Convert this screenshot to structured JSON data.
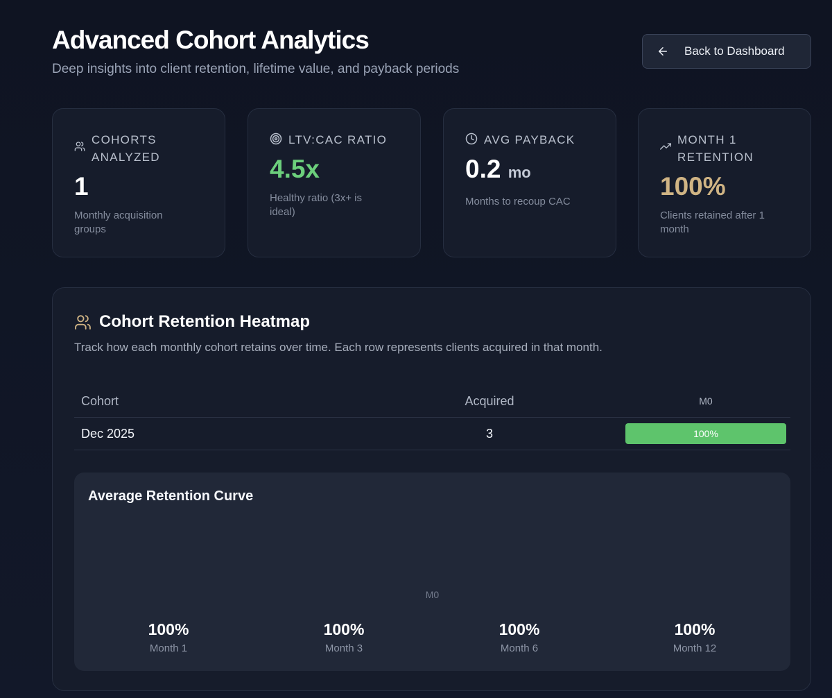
{
  "header": {
    "title": "Advanced Cohort Analytics",
    "subtitle": "Deep insights into client retention, lifetime value, and payback periods",
    "back_button": "Back to Dashboard",
    "back_icon": "arrow-left-icon"
  },
  "stats": [
    {
      "icon": "users-icon",
      "label": "COHORTS ANALYZED",
      "value": "1",
      "unit": "",
      "note": "Monthly acquisition groups",
      "color": "#ffffff"
    },
    {
      "icon": "target-icon",
      "label": "LTV:CAC RATIO",
      "value": "4.5x",
      "unit": "",
      "note": "Healthy ratio (3x+ is ideal)",
      "color": "#6ccf7c"
    },
    {
      "icon": "clock-icon",
      "label": "AVG PAYBACK",
      "value": "0.2",
      "unit": "mo",
      "note": "Months to recoup CAC",
      "color": "#ffffff"
    },
    {
      "icon": "trending-up-icon",
      "label": "MONTH 1 RETENTION",
      "value": "100%",
      "unit": "",
      "note": "Clients retained after 1 month",
      "color": "#d0b484"
    }
  ],
  "heatmap": {
    "title": "Cohort Retention Heatmap",
    "icon": "users-icon",
    "description": "Track how each monthly cohort retains over time. Each row represents clients acquired in that month.",
    "columns": [
      "Cohort",
      "Acquired",
      "M0"
    ],
    "rows": [
      {
        "cohort": "Dec 2025",
        "acquired": "3",
        "m0": "100%",
        "m0_color": "#5ec46c"
      }
    ]
  },
  "curve": {
    "title": "Average Retention Curve",
    "axis_label": "M0",
    "summary": [
      {
        "value": "100%",
        "label": "Month 1"
      },
      {
        "value": "100%",
        "label": "Month 3"
      },
      {
        "value": "100%",
        "label": "Month 6"
      },
      {
        "value": "100%",
        "label": "Month 12"
      }
    ]
  },
  "colors": {
    "background": "#0f1421",
    "card": "#161c2b",
    "accent_green": "#6ccf7c",
    "accent_gold": "#d0b484",
    "heat_green": "#5ec46c"
  }
}
